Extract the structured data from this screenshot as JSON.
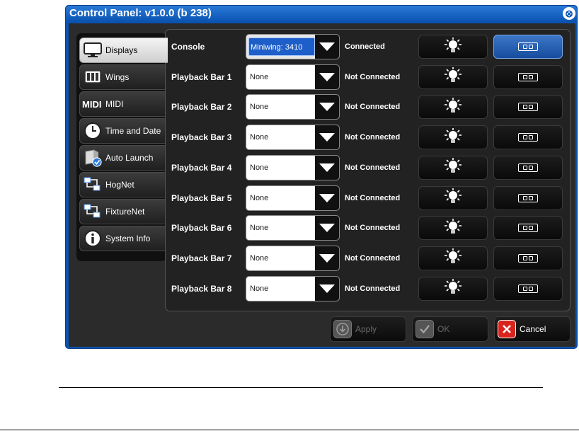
{
  "window": {
    "title": "Control Panel: v1.0.0 (b 238)",
    "close_glyph": "⊗"
  },
  "sidebar": {
    "items": [
      {
        "label": "Displays",
        "icon": "monitor-icon",
        "active": true
      },
      {
        "label": "Wings",
        "icon": "wing-icon",
        "active": false
      },
      {
        "label": "MIDI",
        "icon": "midi-icon",
        "active": false
      },
      {
        "label": "Time and Date",
        "icon": "clock-icon",
        "active": false
      },
      {
        "label": "Auto Launch",
        "icon": "auto-launch-icon",
        "active": false
      },
      {
        "label": "HogNet",
        "icon": "network-icon",
        "active": false
      },
      {
        "label": "FixtureNet",
        "icon": "network-icon",
        "active": false
      },
      {
        "label": "System Info",
        "icon": "info-icon",
        "active": false
      }
    ]
  },
  "rows": [
    {
      "label": "Console",
      "value": "Miniwing: 3410",
      "status": "Connected"
    },
    {
      "label": "Playback Bar 1",
      "value": "None",
      "status": "Not Connected"
    },
    {
      "label": "Playback Bar 2",
      "value": "None",
      "status": "Not Connected"
    },
    {
      "label": "Playback Bar 3",
      "value": "None",
      "status": "Not Connected"
    },
    {
      "label": "Playback Bar 4",
      "value": "None",
      "status": "Not Connected"
    },
    {
      "label": "Playback Bar 5",
      "value": "None",
      "status": "Not Connected"
    },
    {
      "label": "Playback Bar 6",
      "value": "None",
      "status": "Not Connected"
    },
    {
      "label": "Playback Bar 7",
      "value": "None",
      "status": "Not Connected"
    },
    {
      "label": "Playback Bar 8",
      "value": "None",
      "status": "Not Connected"
    }
  ],
  "footer": {
    "apply_label": "Apply",
    "ok_label": "OK",
    "cancel_label": "Cancel"
  },
  "colors": {
    "window_blue": "#0c53b0",
    "selected_blue": "#1e5ec8",
    "cancel_red": "#d8241c"
  }
}
